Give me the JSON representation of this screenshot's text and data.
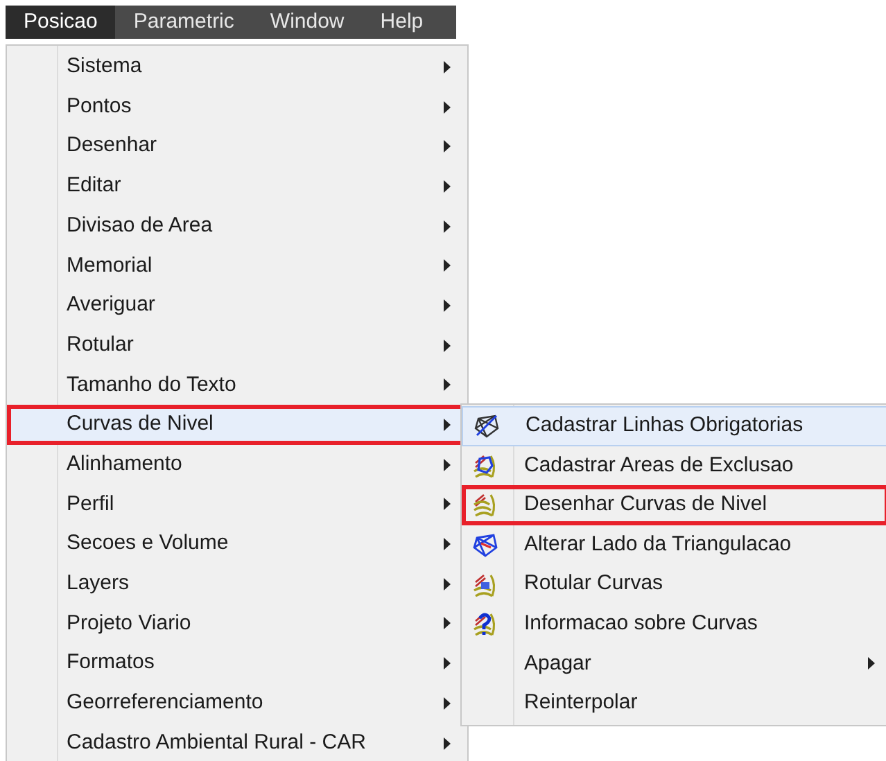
{
  "menubar": [
    {
      "label": "Posicao",
      "selected": true
    },
    {
      "label": "Parametric",
      "selected": false
    },
    {
      "label": "Window",
      "selected": false
    },
    {
      "label": "Help",
      "selected": false
    }
  ],
  "menu": {
    "items": [
      {
        "label": "Sistema",
        "has_submenu": true,
        "hovered": false,
        "outlined": false
      },
      {
        "label": "Pontos",
        "has_submenu": true,
        "hovered": false,
        "outlined": false
      },
      {
        "label": "Desenhar",
        "has_submenu": true,
        "hovered": false,
        "outlined": false
      },
      {
        "label": "Editar",
        "has_submenu": true,
        "hovered": false,
        "outlined": false
      },
      {
        "label": "Divisao de Area",
        "has_submenu": true,
        "hovered": false,
        "outlined": false
      },
      {
        "label": "Memorial",
        "has_submenu": true,
        "hovered": false,
        "outlined": false
      },
      {
        "label": "Averiguar",
        "has_submenu": true,
        "hovered": false,
        "outlined": false
      },
      {
        "label": "Rotular",
        "has_submenu": true,
        "hovered": false,
        "outlined": false
      },
      {
        "label": "Tamanho do Texto",
        "has_submenu": true,
        "hovered": false,
        "outlined": false
      },
      {
        "label": "Curvas de Nivel",
        "has_submenu": true,
        "hovered": true,
        "outlined": true
      },
      {
        "label": "Alinhamento",
        "has_submenu": true,
        "hovered": false,
        "outlined": false
      },
      {
        "label": "Perfil",
        "has_submenu": true,
        "hovered": false,
        "outlined": false
      },
      {
        "label": "Secoes e Volume",
        "has_submenu": true,
        "hovered": false,
        "outlined": false
      },
      {
        "label": "Layers",
        "has_submenu": true,
        "hovered": false,
        "outlined": false
      },
      {
        "label": "Projeto Viario",
        "has_submenu": true,
        "hovered": false,
        "outlined": false
      },
      {
        "label": "Formatos",
        "has_submenu": true,
        "hovered": false,
        "outlined": false
      },
      {
        "label": "Georreferenciamento",
        "has_submenu": true,
        "hovered": false,
        "outlined": false
      },
      {
        "label": "Cadastro Ambiental Rural - CAR",
        "has_submenu": true,
        "hovered": false,
        "outlined": false
      }
    ]
  },
  "submenu": {
    "items": [
      {
        "label": "Cadastrar Linhas Obrigatorias",
        "kind": "icon",
        "has_submenu": false,
        "hovered": true,
        "outlined": false
      },
      {
        "label": "Cadastrar Areas de Exclusao",
        "kind": "icon",
        "has_submenu": false,
        "hovered": false,
        "outlined": false
      },
      {
        "label": "Desenhar Curvas de Nivel",
        "kind": "icon",
        "has_submenu": false,
        "hovered": false,
        "outlined": true
      },
      {
        "label": "Alterar Lado da Triangulacao",
        "kind": "icon",
        "has_submenu": false,
        "hovered": false,
        "outlined": false
      },
      {
        "label": "Rotular Curvas",
        "kind": "icon",
        "has_submenu": false,
        "hovered": false,
        "outlined": false
      },
      {
        "label": "Informacao sobre Curvas",
        "kind": "icon",
        "has_submenu": false,
        "hovered": false,
        "outlined": false
      },
      {
        "label": "Apagar",
        "kind": "plain",
        "has_submenu": true,
        "hovered": false,
        "outlined": false
      },
      {
        "label": "Reinterpolar",
        "kind": "plain",
        "has_submenu": false,
        "hovered": false,
        "outlined": false
      }
    ]
  }
}
